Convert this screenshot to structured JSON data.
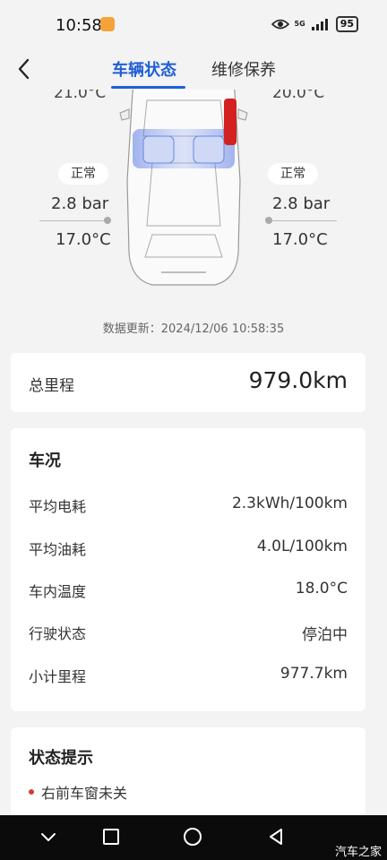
{
  "status_bar": {
    "time": "10:58",
    "network": "5G",
    "battery": "95"
  },
  "header": {
    "tabs": [
      {
        "label": "车辆状态",
        "active": true
      },
      {
        "label": "维修保养",
        "active": false
      }
    ]
  },
  "tires": {
    "front_left_temp": "21.0°C",
    "front_right_temp": "20.0°C",
    "rear_left": {
      "status": "正常",
      "pressure": "2.8 bar",
      "temp": "17.0°C"
    },
    "rear_right": {
      "status": "正常",
      "pressure": "2.8 bar",
      "temp": "17.0°C"
    }
  },
  "update_text": "数据更新：2024/12/06 10:58:35",
  "total_mileage": {
    "label": "总里程",
    "value": "979.0km"
  },
  "condition": {
    "title": "车况",
    "rows": [
      {
        "label": "平均电耗",
        "value": "2.3kWh/100km"
      },
      {
        "label": "平均油耗",
        "value": "4.0L/100km"
      },
      {
        "label": "车内温度",
        "value": "18.0°C"
      },
      {
        "label": "行驶状态",
        "value": "停泊中"
      },
      {
        "label": "小计里程",
        "value": "977.7km"
      }
    ]
  },
  "status_hints": {
    "title": "状态提示",
    "items": [
      "右前车窗未关"
    ]
  },
  "watermark": "汽车之家",
  "colors": {
    "accent": "#1f5fd6",
    "alert": "#d43b3b",
    "window_open": "#d32020"
  }
}
